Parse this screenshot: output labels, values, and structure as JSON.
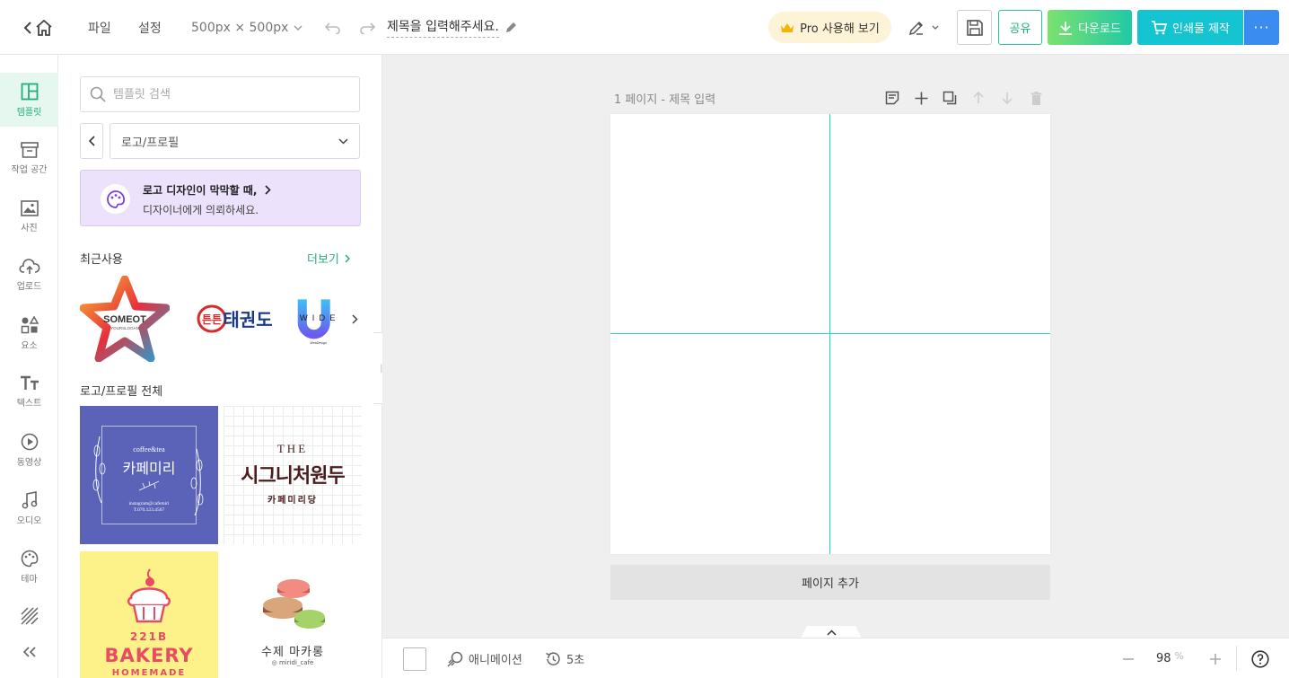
{
  "header": {
    "file_label": "파일",
    "settings_label": "설정",
    "size_label": "500px × 500px",
    "title_value": "제목을 입력해주세요.",
    "pro_label": "Pro 사용해 보기",
    "share_label": "공유",
    "download_label": "다운로드",
    "print_label": "인쇄물 제작",
    "more_label": "···",
    "accent_color": "#20c997"
  },
  "rail": {
    "items": [
      {
        "label": "템플릿",
        "icon": "template-icon"
      },
      {
        "label": "작업 공간",
        "icon": "archive-icon"
      },
      {
        "label": "사진",
        "icon": "image-icon"
      },
      {
        "label": "업로드",
        "icon": "cloud-upload-icon"
      },
      {
        "label": "요소",
        "icon": "shapes-icon"
      },
      {
        "label": "텍스트",
        "icon": "text-icon"
      },
      {
        "label": "동영상",
        "icon": "play-icon"
      },
      {
        "label": "오디오",
        "icon": "music-note-icon"
      },
      {
        "label": "테마",
        "icon": "palette-icon"
      }
    ]
  },
  "panel": {
    "search_placeholder": "템플릿 검색",
    "category_value": "로고/프로필",
    "promo_title": "로고 디자인이 막막할 때,",
    "promo_sub": "디자이너에게 의뢰하세요.",
    "recent_title": "최근사용",
    "more_label": "더보기",
    "all_title": "로고/프로필 전체",
    "recent": [
      {
        "text": "SOMEOT",
        "sub": "YOURSLOGAN"
      },
      {
        "text": "태권도",
        "badge": "튼튼"
      },
      {
        "text": "WIDE",
        "sub": "WebDesign"
      }
    ],
    "tiles": [
      {
        "small": "coffee&tea",
        "name": "카페미리",
        "line1": "instagram@cafemiri",
        "line2": "T.070.123.4567"
      },
      {
        "small": "THE",
        "name": "시그니처원두",
        "line1": "카페미리당"
      },
      {
        "small": "221B",
        "name": "BAKERY",
        "line1": "HOMEMADE"
      },
      {
        "name": "수제 마카롱",
        "line1": "◎ miridi_cafe"
      }
    ]
  },
  "workspace": {
    "page_label": "1 페이지 - 제목 입력",
    "add_page_label": "페이지 추가"
  },
  "bottombar": {
    "animation_label": "애니메이션",
    "duration_label": "5초",
    "zoom_value": "98",
    "zoom_unit": "%"
  }
}
